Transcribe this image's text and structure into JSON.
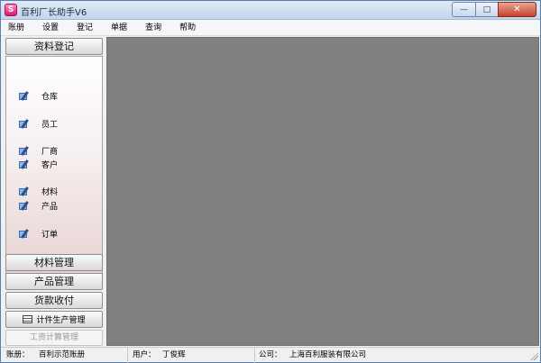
{
  "window": {
    "title": "百利厂长助手V6",
    "icon_letter": "S",
    "controls": {
      "minimize": "—",
      "maximize": "□",
      "close": "✕"
    }
  },
  "menu": [
    "账册",
    "设置",
    "登记",
    "单据",
    "查询",
    "帮助"
  ],
  "sidebar": {
    "active_section": "资料登记",
    "nav_items": [
      "仓库",
      "员工",
      "厂商",
      "客户",
      "材料",
      "产品",
      "订单"
    ],
    "sections": [
      "材料管理",
      "产品管理",
      "货款收付"
    ],
    "piecework": "计件生产管理",
    "payroll_disabled": "工资计算管理"
  },
  "statusbar": {
    "account_label": "账册：",
    "account_value": "百利示范账册",
    "user_label": "用户：",
    "user_value": "丁俊辉",
    "company_label": "公司：",
    "company_value": "上海百利服装有限公司"
  },
  "colors": {
    "workspace": "#808080",
    "titlebar": "#c4d6ec",
    "close_button": "#c6432b",
    "app_icon": "#d4186c"
  }
}
